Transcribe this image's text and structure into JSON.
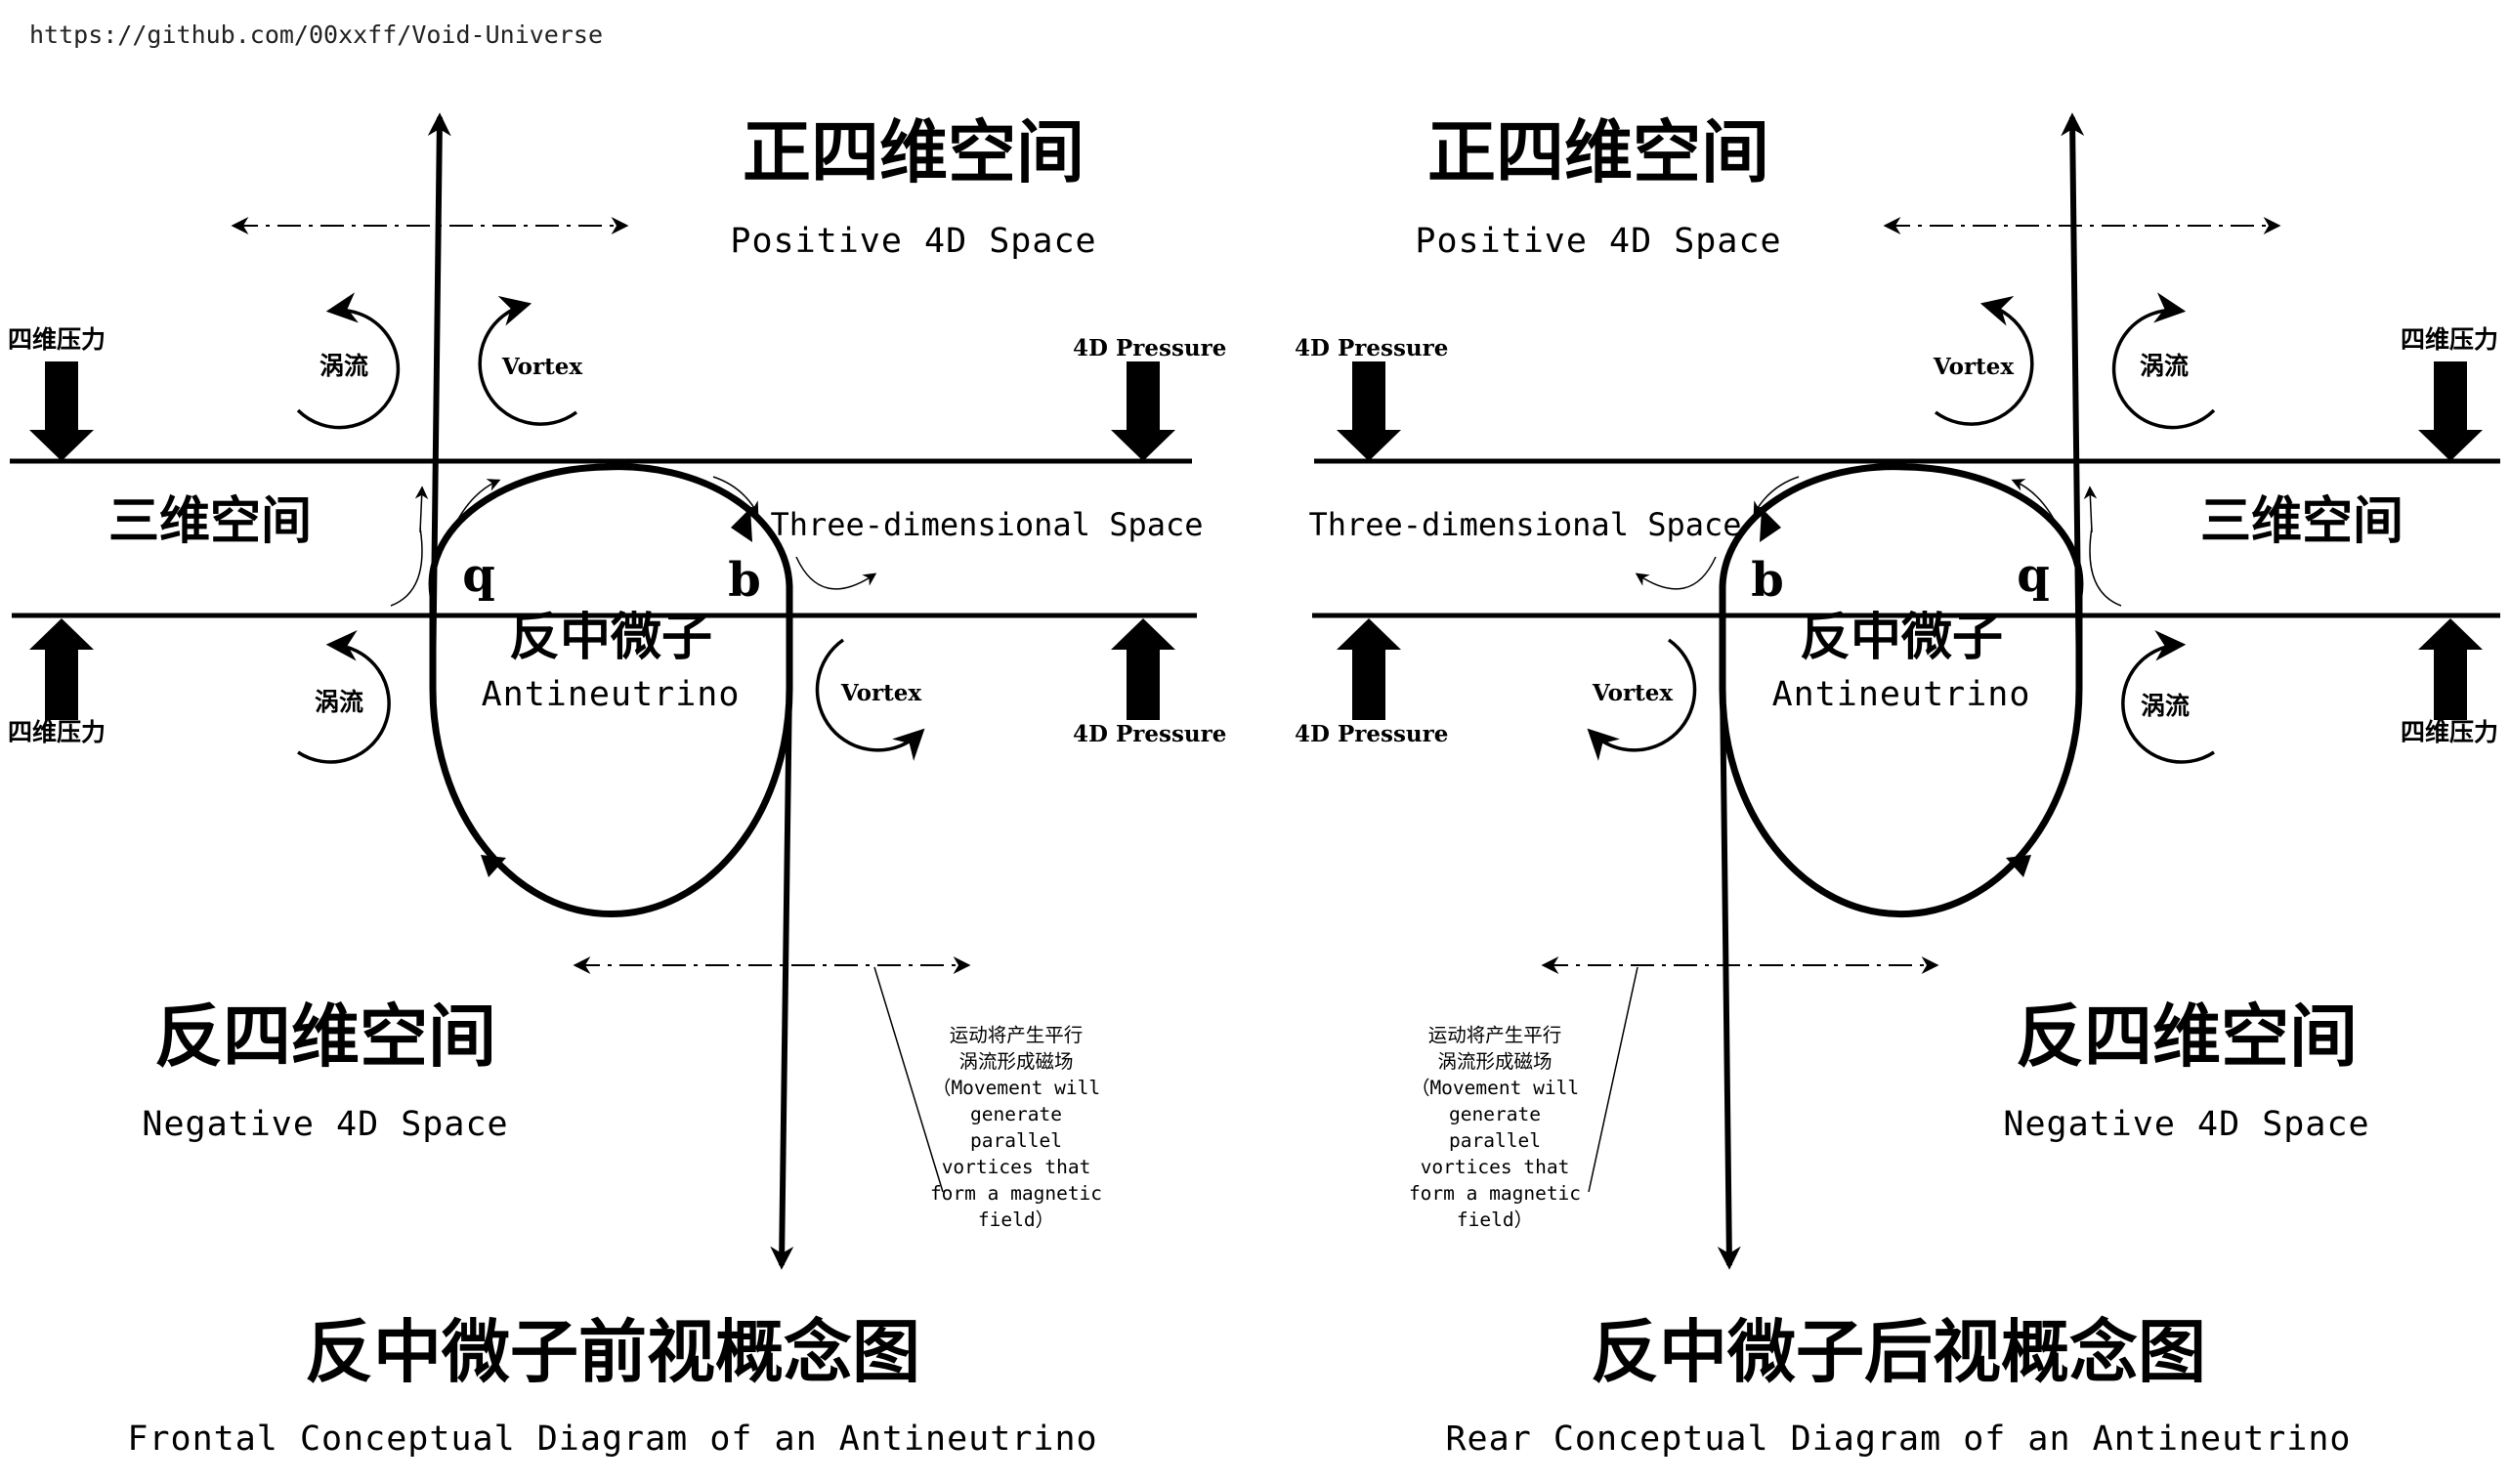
{
  "url": "https://github.com/00xxff/Void-Universe",
  "front": {
    "positive_cn": "正四维空间",
    "positive_en": "Positive 4D Space",
    "negative_cn": "反四维空间",
    "negative_en": "Negative 4D Space",
    "three_d_cn": "三维空间",
    "three_d_en": "Three-dimensional Space",
    "particle_cn": "反中微子",
    "particle_en": "Antineutrino",
    "label_q": "q",
    "label_b": "b",
    "vortex_cn_top": "涡流",
    "vortex_cn_bottom": "涡流",
    "vortex_en_top": "Vortex",
    "vortex_en_bottom": "Vortex",
    "pressure_cn_top": "四维压力",
    "pressure_cn_bottom": "四维压力",
    "pressure_en_top": "4D Pressure",
    "pressure_en_bottom": "4D Pressure",
    "note_lines": [
      "运动将产生平行",
      "涡流形成磁场",
      "（Movement will",
      "generate",
      "parallel",
      "vortices that",
      "form a magnetic",
      "field）"
    ],
    "title_cn": "反中微子前视概念图",
    "title_en": "Frontal Conceptual Diagram of an Antineutrino"
  },
  "rear": {
    "positive_cn": "正四维空间",
    "positive_en": "Positive 4D Space",
    "negative_cn": "反四维空间",
    "negative_en": "Negative 4D Space",
    "three_d_cn": "三维空间",
    "three_d_en": "Three-dimensional Space",
    "particle_cn": "反中微子",
    "particle_en": "Antineutrino",
    "label_q": "q",
    "label_b": "b",
    "vortex_cn_top": "涡流",
    "vortex_cn_bottom": "涡流",
    "vortex_en_top": "Vortex",
    "vortex_en_bottom": "Vortex",
    "pressure_cn_top": "四维压力",
    "pressure_cn_bottom": "四维压力",
    "pressure_en_top": "4D Pressure",
    "pressure_en_bottom": "4D Pressure",
    "note_lines": [
      "运动将产生平行",
      "涡流形成磁场",
      "（Movement will",
      "generate",
      "parallel",
      "vortices that",
      "form a magnetic",
      "field）"
    ],
    "title_cn": "反中微子后视概念图",
    "title_en": "Rear Conceptual Diagram of an Antineutrino"
  }
}
